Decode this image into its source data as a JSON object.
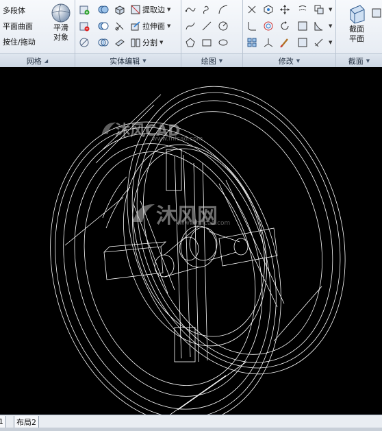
{
  "ribbon": {
    "mesh_panel": {
      "title": "网格",
      "commands": [
        "多段体",
        "平面曲面",
        "按住/拖动"
      ],
      "smooth_object": [
        "平滑",
        "对象"
      ]
    },
    "solid_edit_panel": {
      "title": "实体编辑",
      "commands": [
        "提取边",
        "拉伸面",
        "分割"
      ]
    },
    "draw_panel": {
      "title": "绘图"
    },
    "modify_panel": {
      "title": "修改"
    },
    "section_panel": {
      "title": "截面",
      "section_plane": [
        "截面",
        "平面"
      ]
    }
  },
  "watermark": {
    "top_text": "沐风CAD",
    "main_text": "沐风网",
    "url": "www.mfcad.com"
  },
  "tabs": [
    "1",
    "布局2"
  ],
  "colors": {
    "viewport": "#000000",
    "wireframe": "#ffffff",
    "ribbon": "#e3e9f1"
  }
}
